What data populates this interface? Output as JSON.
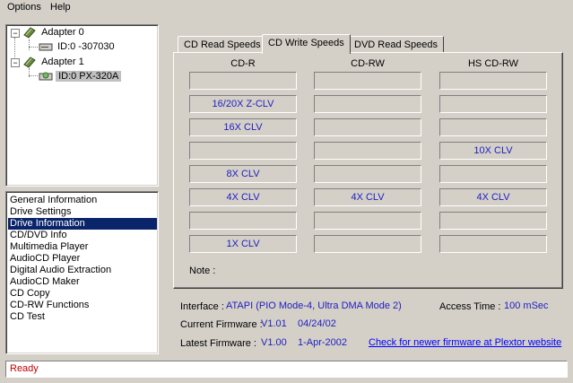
{
  "menu": {
    "items": [
      "Options",
      "Help"
    ]
  },
  "tree": {
    "adapter0": {
      "label": "Adapter 0",
      "device": "ID:0  -307030"
    },
    "adapter1": {
      "label": "Adapter 1",
      "device": "ID:0  PX-320A"
    }
  },
  "features": [
    "General Information",
    "Drive Settings",
    "Drive Information",
    "CD/DVD Info",
    "Multimedia Player",
    "AudioCD Player",
    "Digital Audio Extraction",
    "AudioCD Maker",
    "CD Copy",
    "CD-RW Functions",
    "CD Test"
  ],
  "selected_feature": "Drive Information",
  "tabs": [
    "CD Read Speeds",
    "CD Write Speeds",
    "DVD Read Speeds"
  ],
  "active_tab": "CD Write Speeds",
  "speeds": {
    "columns": [
      "CD-R",
      "CD-RW",
      "HS CD-RW"
    ],
    "rows": [
      [
        "",
        "",
        ""
      ],
      [
        "16/20X Z-CLV",
        "",
        ""
      ],
      [
        "16X CLV",
        "",
        ""
      ],
      [
        "",
        "",
        "10X CLV"
      ],
      [
        "8X CLV",
        "",
        ""
      ],
      [
        "4X CLV",
        "4X CLV",
        "4X CLV"
      ],
      [
        "",
        "",
        ""
      ],
      [
        "1X CLV",
        "",
        ""
      ]
    ],
    "note_label": "Note :"
  },
  "info": {
    "interface_label": "Interface :",
    "interface_value": "ATAPI (PIO Mode-4, Ultra DMA Mode 2)",
    "access_label": "Access Time :",
    "access_value": "100 mSec",
    "current_fw_label": "Current Firmware :",
    "current_fw_version": "V1.01",
    "current_fw_date": "04/24/02",
    "latest_fw_label": "Latest Firmware :",
    "latest_fw_version": "V1.00",
    "latest_fw_date": "1-Apr-2002",
    "check_link": "Check for newer firmware at Plextor website"
  },
  "status": {
    "text": "Ready"
  },
  "colors": {
    "selection": "#0a246a",
    "value_text": "#2020c0",
    "link": "#0000ff",
    "status": "#c00000"
  }
}
